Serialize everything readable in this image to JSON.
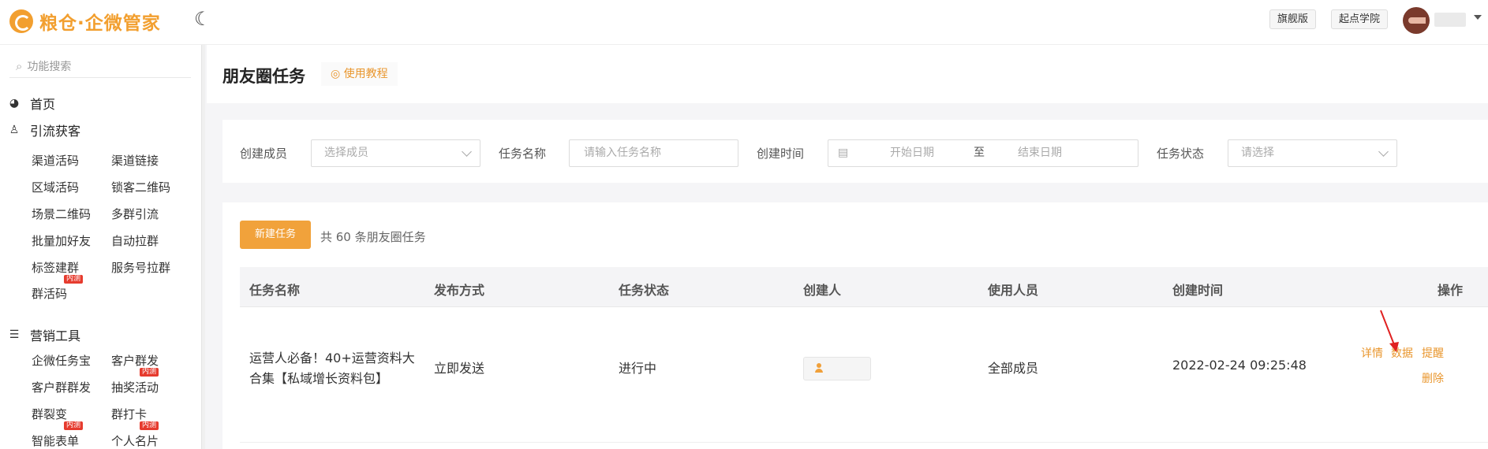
{
  "header": {
    "logo_text": "粮仓·企微管家",
    "theme_icon": "moon-icon",
    "btn_flagship": "旗舰版",
    "btn_academy": "起点学院"
  },
  "sidebar": {
    "search_placeholder": "功能搜索",
    "home": "首页",
    "section1": "引流获客",
    "section1_items": [
      "渠道活码",
      "渠道链接",
      "区域活码",
      "锁客二维码",
      "场景二维码",
      "多群引流",
      "批量加好友",
      "自动拉群",
      "标签建群",
      "服务号拉群",
      "群活码"
    ],
    "section2": "营销工具",
    "section2_items": [
      "企微任务宝",
      "客户群发",
      "客户群群发",
      "抽奖活动",
      "群裂变",
      "群打卡",
      "智能表单",
      "个人名片"
    ],
    "badge": "内测"
  },
  "page": {
    "title": "朋友圈任务",
    "tutorial": "使用教程"
  },
  "filters": {
    "creator_label": "创建成员",
    "creator_placeholder": "选择成员",
    "task_name_label": "任务名称",
    "task_name_placeholder": "请输入任务名称",
    "created_time_label": "创建时间",
    "start_placeholder": "开始日期",
    "range_sep": "至",
    "end_placeholder": "结束日期",
    "status_label": "任务状态",
    "status_placeholder": "请选择"
  },
  "table": {
    "new_button": "新建任务",
    "count_text": "共 60 条朋友圈任务",
    "columns": [
      "任务名称",
      "发布方式",
      "任务状态",
      "创建人",
      "使用人员",
      "创建时间",
      "操作"
    ],
    "rows": [
      {
        "name_line1": "运营人必备！40+运营资料大",
        "name_line2": "合集【私域增长资料包】",
        "publish": "立即发送",
        "status": "进行中",
        "users": "全部成员",
        "created": "2022-02-24 09:25:48",
        "ops": [
          "详情",
          "数据",
          "提醒",
          "删除"
        ]
      }
    ]
  },
  "colors": {
    "accent": "#f1a23b",
    "link": "#e9962d",
    "badge": "#e63b2e",
    "annotation_arrow": "#e02020"
  }
}
